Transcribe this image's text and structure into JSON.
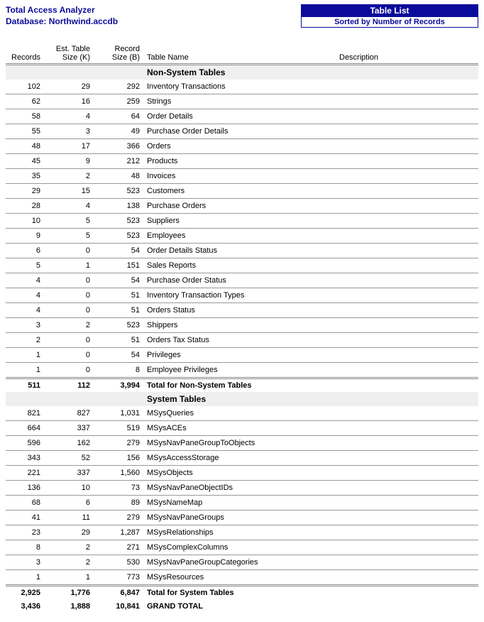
{
  "header": {
    "app_title": "Total Access Analyzer",
    "db_label": "Database: Northwind.accdb",
    "report_title": "Table List",
    "sort_text": "Sorted by Number of Records"
  },
  "columns": {
    "records": "Records",
    "est_size": "Est. Table\nSize (K)",
    "rec_size": "Record\nSize (B)",
    "table_name": "Table Name",
    "description": "Description"
  },
  "section_nonsys": {
    "title": "Non-System Tables",
    "rows": [
      {
        "records": "102",
        "est": "29",
        "bytes": "292",
        "name": "Inventory Transactions"
      },
      {
        "records": "62",
        "est": "16",
        "bytes": "259",
        "name": "Strings"
      },
      {
        "records": "58",
        "est": "4",
        "bytes": "64",
        "name": "Order Details"
      },
      {
        "records": "55",
        "est": "3",
        "bytes": "49",
        "name": "Purchase Order Details"
      },
      {
        "records": "48",
        "est": "17",
        "bytes": "366",
        "name": "Orders"
      },
      {
        "records": "45",
        "est": "9",
        "bytes": "212",
        "name": "Products"
      },
      {
        "records": "35",
        "est": "2",
        "bytes": "48",
        "name": "Invoices"
      },
      {
        "records": "29",
        "est": "15",
        "bytes": "523",
        "name": "Customers"
      },
      {
        "records": "28",
        "est": "4",
        "bytes": "138",
        "name": "Purchase Orders"
      },
      {
        "records": "10",
        "est": "5",
        "bytes": "523",
        "name": "Suppliers"
      },
      {
        "records": "9",
        "est": "5",
        "bytes": "523",
        "name": "Employees"
      },
      {
        "records": "6",
        "est": "0",
        "bytes": "54",
        "name": "Order Details Status"
      },
      {
        "records": "5",
        "est": "1",
        "bytes": "151",
        "name": "Sales Reports"
      },
      {
        "records": "4",
        "est": "0",
        "bytes": "54",
        "name": "Purchase Order Status"
      },
      {
        "records": "4",
        "est": "0",
        "bytes": "51",
        "name": "Inventory Transaction Types"
      },
      {
        "records": "4",
        "est": "0",
        "bytes": "51",
        "name": "Orders Status"
      },
      {
        "records": "3",
        "est": "2",
        "bytes": "523",
        "name": "Shippers"
      },
      {
        "records": "2",
        "est": "0",
        "bytes": "51",
        "name": "Orders Tax Status"
      },
      {
        "records": "1",
        "est": "0",
        "bytes": "54",
        "name": "Privileges"
      },
      {
        "records": "1",
        "est": "0",
        "bytes": "8",
        "name": "Employee Privileges"
      }
    ],
    "subtotal": {
      "records": "511",
      "est": "112",
      "bytes": "3,994",
      "label": "Total for Non-System Tables"
    }
  },
  "section_sys": {
    "title": "System Tables",
    "rows": [
      {
        "records": "821",
        "est": "827",
        "bytes": "1,031",
        "name": "MSysQueries"
      },
      {
        "records": "664",
        "est": "337",
        "bytes": "519",
        "name": "MSysACEs"
      },
      {
        "records": "596",
        "est": "162",
        "bytes": "279",
        "name": "MSysNavPaneGroupToObjects"
      },
      {
        "records": "343",
        "est": "52",
        "bytes": "156",
        "name": "MSysAccessStorage"
      },
      {
        "records": "221",
        "est": "337",
        "bytes": "1,560",
        "name": "MSysObjects"
      },
      {
        "records": "136",
        "est": "10",
        "bytes": "73",
        "name": "MSysNavPaneObjectIDs"
      },
      {
        "records": "68",
        "est": "6",
        "bytes": "89",
        "name": "MSysNameMap"
      },
      {
        "records": "41",
        "est": "11",
        "bytes": "279",
        "name": "MSysNavPaneGroups"
      },
      {
        "records": "23",
        "est": "29",
        "bytes": "1,287",
        "name": "MSysRelationships"
      },
      {
        "records": "8",
        "est": "2",
        "bytes": "271",
        "name": "MSysComplexColumns"
      },
      {
        "records": "3",
        "est": "2",
        "bytes": "530",
        "name": "MSysNavPaneGroupCategories"
      },
      {
        "records": "1",
        "est": "1",
        "bytes": "773",
        "name": "MSysResources"
      }
    ],
    "subtotal": {
      "records": "2,925",
      "est": "1,776",
      "bytes": "6,847",
      "label": "Total for System Tables"
    }
  },
  "grand_total": {
    "records": "3,436",
    "est": "1,888",
    "bytes": "10,841",
    "label": "GRAND TOTAL"
  }
}
